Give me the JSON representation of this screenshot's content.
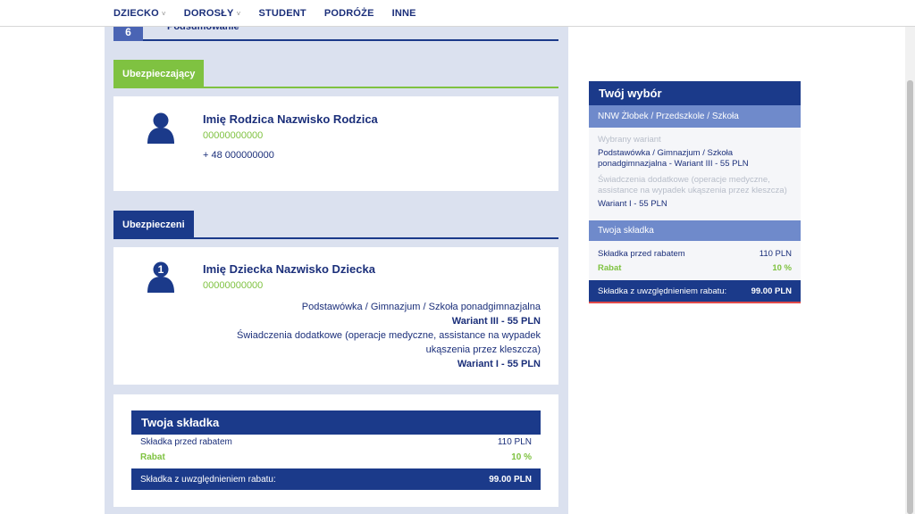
{
  "nav": {
    "items": [
      {
        "label": "DZIECKO",
        "has_dropdown": true
      },
      {
        "label": "DOROSŁY",
        "has_dropdown": true
      },
      {
        "label": "STUDENT",
        "has_dropdown": false
      },
      {
        "label": "PODRÓŻE",
        "has_dropdown": false
      },
      {
        "label": "INNE",
        "has_dropdown": false
      }
    ],
    "chevron": "˅"
  },
  "step": {
    "number": "6",
    "title": "Podsumowanie"
  },
  "insurer_section": {
    "label": "Ubezpieczający",
    "name": "Imię Rodzica Nazwisko Rodzica",
    "pesel": "00000000000",
    "phone": "+ 48 000000000",
    "icon": "person-icon"
  },
  "insured_section": {
    "label": "Ubezpieczeni",
    "badge": "1",
    "name": "Imię Dziecka Nazwisko Dziecka",
    "pesel": "00000000000",
    "details": [
      {
        "text": "Podstawówka / Gimnazjum / Szkoła ponadgimnazjalna",
        "bold": false
      },
      {
        "text": "Wariant III - 55 PLN",
        "bold": true
      },
      {
        "text": "Świadczenia dodatkowe (operacje medyczne, assistance na wypadek ukąszenia przez kleszcza)",
        "bold": false
      },
      {
        "text": "Wariant I - 55 PLN",
        "bold": true
      }
    ]
  },
  "premium": {
    "title": "Twoja składka",
    "before_label": "Składka przed rabatem",
    "before_value": "110 PLN",
    "discount_label": "Rabat",
    "discount_value": "10 %",
    "total_label": "Składka z uwzględnieniem rabatu:",
    "total_value": "99.00 PLN"
  },
  "sidebar": {
    "title": "Twój wybór",
    "product": "NNW Żłobek / Przedszkole / Szkoła",
    "variant_label": "Wybrany wariant",
    "variant_value": "Podstawówka / Gimnazjum / Szkoła ponadgimnazjalna - Wariant III - 55 PLN",
    "extra_label": "Świadczenia dodatkowe (operacje medyczne, assistance na wypadek ukąszenia przez kleszcza)",
    "extra_value": "Wariant I - 55 PLN",
    "premium_title": "Twoja składka",
    "before_label": "Składka przed rabatem",
    "before_value": "110 PLN",
    "discount_label": "Rabat",
    "discount_value": "10 %",
    "total_label": "Składka z uwzględnieniem rabatu:",
    "total_value": "99.00 PLN"
  },
  "colors": {
    "navy": "#1b3a8a",
    "green": "#7fc241",
    "light_blue": "#6f8acb",
    "panel_bg": "#dbe1ef",
    "accent_red": "#e04a4a"
  }
}
